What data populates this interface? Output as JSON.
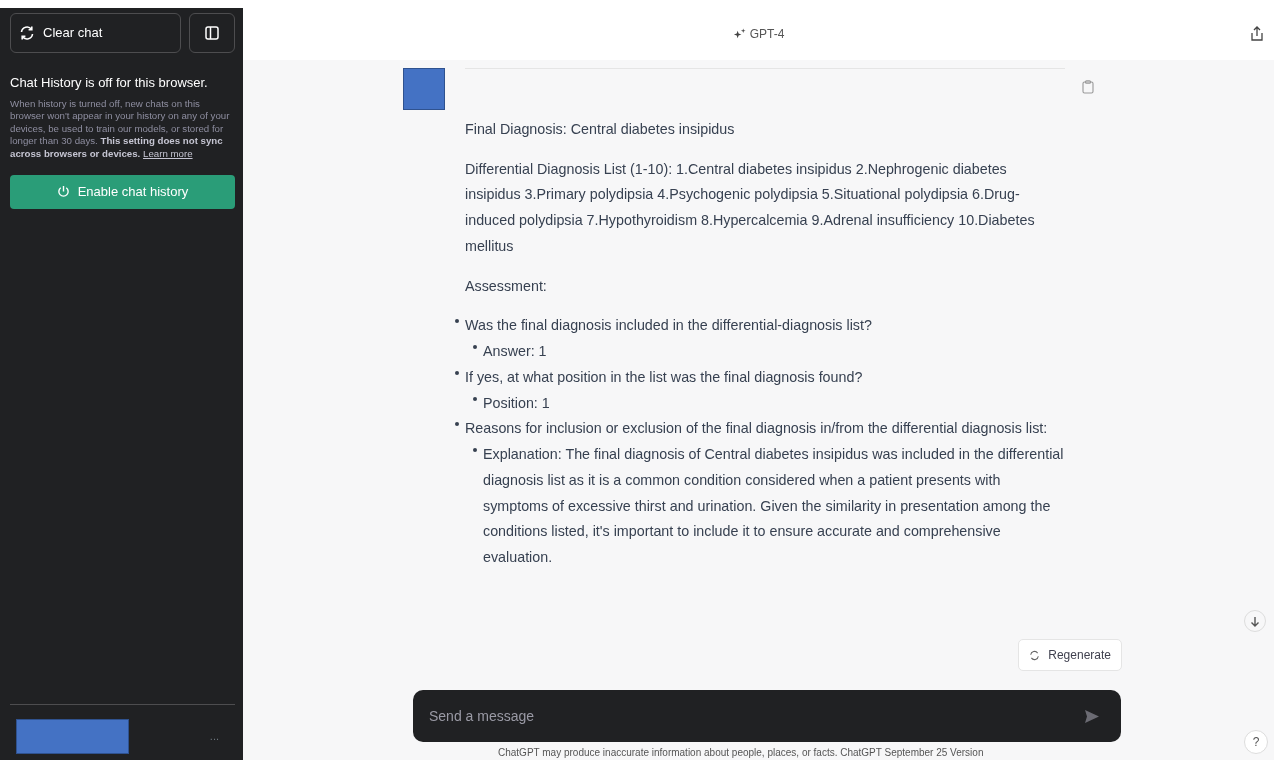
{
  "sidebar": {
    "clear_button": "Clear chat",
    "notice_title": "Chat History is off for this browser.",
    "notice_body": "When history is turned off, new chats on this browser won't appear in your history on any of your devices, be used to train our models, or stored for longer than 30 days. **This setting does not sync across browsers or devices.**",
    "learn_more": "Learn more",
    "enable_button": "Enable chat history",
    "user_menu": "..."
  },
  "header": {
    "model": "GPT-4"
  },
  "message": {
    "paragraphs": [
      "Final Diagnosis: Central diabetes insipidus",
      "Differential Diagnosis List (1-10): 1.Central diabetes insipidus 2.Nephrogenic diabetes insipidus 3.Primary polydipsia 4.Psychogenic polydipsia 5.Situational polydipsia 6.Drug-induced polydipsia 7.Hypothyroidism 8.Hypercalcemia 9.Adrenal insufficiency 10.Diabetes mellitus",
      "Assessment:"
    ],
    "bullets": [
      {
        "text": "Was the final diagnosis included in the differential-diagnosis list?",
        "children": [
          {
            "text": "Answer: 1"
          }
        ]
      },
      {
        "text": "If yes, at what position in the list was the final diagnosis found?",
        "children": [
          {
            "text": "Position: 1"
          }
        ]
      },
      {
        "text": "Reasons for inclusion or exclusion of the final diagnosis in/from the differential diagnosis list:",
        "children": [
          {
            "text": "Explanation: The final diagnosis of Central diabetes insipidus was included in the differential diagnosis list as it is a common condition considered when a patient presents with symptoms of excessive thirst and urination. Given the similarity in presentation among the conditions listed, it's important to include it to ensure accurate and comprehensive evaluation."
          }
        ]
      }
    ]
  },
  "regenerate_button": "Regenerate",
  "composer": {
    "placeholder": "Send a message"
  },
  "footer": "ChatGPT may produce inaccurate information about people, places, or facts. ChatGPT September 25 Version",
  "help_button": "?"
}
